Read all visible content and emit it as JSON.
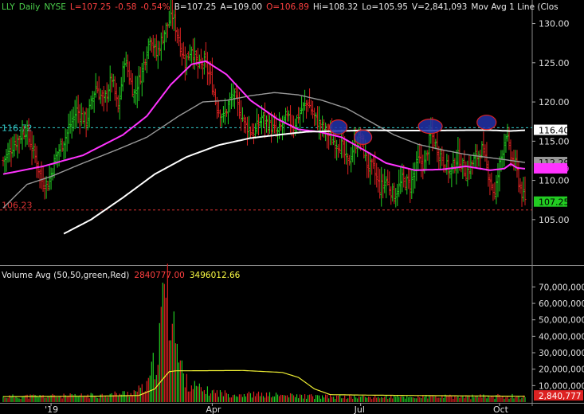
{
  "header": {
    "symbol": "LLY",
    "period": "Daily",
    "exchange": "NYSE",
    "last": "L=107.25",
    "change": "-0.58",
    "change_pct": "-0.54%",
    "bid": "B=107.25",
    "ask": "A=109.00",
    "open": "O=106.89",
    "high": "Hi=108.32",
    "low": "Lo=105.95",
    "volume": "V=2,841,093",
    "indicator": "Mov Avg 1 Line (Clos"
  },
  "volume_header": {
    "title": "Volume Avg (50,50,green,Red)",
    "vol": "2840777.00",
    "avg": "3496012.66"
  },
  "colors": {
    "up": "#22cc22",
    "down": "#dd2222",
    "ma50": "#ff33ff",
    "ma100": "#999999",
    "ma200": "#ffffff",
    "vol_avg": "#eeee33",
    "cyan_line": "#33cccc",
    "red_line": "#dd3333",
    "ellipse_fill": "#2233aa",
    "ellipse_edge": "#dd2222"
  },
  "chart_data": [
    {
      "type": "candlestick",
      "title": "",
      "price_axis_labels": [
        "130.00",
        "125.00",
        "120.00",
        "115.00",
        "110.00",
        "105.00"
      ],
      "ylim": [
        99.2,
        133
      ],
      "x_labels": [
        "'19",
        "Apr",
        "Jul",
        "Oct"
      ],
      "x_label_pos_days": [
        30,
        131,
        224,
        311
      ],
      "days_total": 327,
      "price_tags": [
        {
          "label": "116.40",
          "value": 116.4,
          "color": "#ffffff",
          "text": "#000000"
        },
        {
          "label": "112.29",
          "value": 112.29,
          "color": "#999999",
          "text": "#000000"
        },
        {
          "label": "111.49",
          "value": 111.49,
          "color": "#ff33ff",
          "text": "#ff33ff"
        },
        {
          "label": "107.25",
          "value": 107.25,
          "color": "#22cc22",
          "text": "#000000"
        }
      ],
      "hlines": [
        {
          "label": "116.72",
          "value": 116.72,
          "color": "#33cccc"
        },
        {
          "label": "106.23",
          "value": 106.23,
          "color": "#dd3333"
        }
      ],
      "close_anchors": [
        [
          0,
          112.5
        ],
        [
          8,
          115
        ],
        [
          14,
          116.5
        ],
        [
          20,
          113
        ],
        [
          24,
          110
        ],
        [
          28,
          109.5
        ],
        [
          33,
          113
        ],
        [
          40,
          116
        ],
        [
          46,
          119
        ],
        [
          52,
          117.5
        ],
        [
          58,
          122
        ],
        [
          63,
          120
        ],
        [
          68,
          123
        ],
        [
          72,
          119
        ],
        [
          76,
          125.5
        ],
        [
          82,
          121
        ],
        [
          87,
          124
        ],
        [
          92,
          128.5
        ],
        [
          96,
          126
        ],
        [
          101,
          129
        ],
        [
          106,
          131
        ],
        [
          110,
          128
        ],
        [
          114,
          125
        ],
        [
          118,
          127
        ],
        [
          122,
          124.5
        ],
        [
          126,
          125
        ],
        [
          130,
          123
        ],
        [
          134,
          119.5
        ],
        [
          138,
          118
        ],
        [
          144,
          121
        ],
        [
          148,
          119
        ],
        [
          152,
          117
        ],
        [
          157,
          116
        ],
        [
          162,
          118
        ],
        [
          167,
          117
        ],
        [
          172,
          116
        ],
        [
          177,
          118
        ],
        [
          182,
          117
        ],
        [
          187,
          119
        ],
        [
          191,
          120
        ],
        [
          195,
          118
        ],
        [
          199,
          117
        ],
        [
          203,
          116
        ],
        [
          207,
          115
        ],
        [
          212,
          114.5
        ],
        [
          216,
          112
        ],
        [
          220,
          114.5
        ],
        [
          224,
          115.5
        ],
        [
          228,
          112
        ],
        [
          232,
          111.5
        ],
        [
          236,
          109
        ],
        [
          240,
          110
        ],
        [
          245,
          108
        ],
        [
          250,
          110
        ],
        [
          255,
          109.5
        ],
        [
          260,
          112.5
        ],
        [
          264,
          112
        ],
        [
          268,
          116
        ],
        [
          272,
          114
        ],
        [
          276,
          112.5
        ],
        [
          280,
          111
        ],
        [
          285,
          113
        ],
        [
          290,
          111
        ],
        [
          295,
          112.5
        ],
        [
          300,
          114
        ],
        [
          304,
          111
        ],
        [
          308,
          108
        ],
        [
          311,
          112
        ],
        [
          315,
          116
        ],
        [
          318,
          113
        ],
        [
          321,
          112
        ],
        [
          324,
          109
        ],
        [
          327,
          107.25
        ]
      ],
      "ma50": [
        [
          0,
          110.8
        ],
        [
          25,
          111.8
        ],
        [
          50,
          113.2
        ],
        [
          75,
          115.8
        ],
        [
          90,
          118.2
        ],
        [
          105,
          122.2
        ],
        [
          118,
          124.8
        ],
        [
          127,
          125.2
        ],
        [
          140,
          123.5
        ],
        [
          155,
          120.2
        ],
        [
          172,
          117.8
        ],
        [
          185,
          116.5
        ],
        [
          198,
          116.2
        ],
        [
          212,
          115.5
        ],
        [
          225,
          114.0
        ],
        [
          240,
          112.2
        ],
        [
          258,
          111.3
        ],
        [
          275,
          111.4
        ],
        [
          290,
          111.8
        ],
        [
          305,
          111.3
        ],
        [
          314,
          111.5
        ],
        [
          318,
          112.1
        ],
        [
          322,
          111.6
        ],
        [
          327,
          111.49
        ]
      ],
      "ma100": [
        [
          0,
          106.5
        ],
        [
          15,
          109.5
        ],
        [
          30,
          110.5
        ],
        [
          50,
          112.2
        ],
        [
          70,
          113.8
        ],
        [
          90,
          115.5
        ],
        [
          110,
          118.2
        ],
        [
          125,
          120.0
        ],
        [
          140,
          120.2
        ],
        [
          155,
          120.8
        ],
        [
          170,
          121.2
        ],
        [
          185,
          120.9
        ],
        [
          200,
          120.2
        ],
        [
          215,
          119.2
        ],
        [
          230,
          117.5
        ],
        [
          245,
          115.8
        ],
        [
          260,
          114.6
        ],
        [
          275,
          113.9
        ],
        [
          290,
          113.3
        ],
        [
          305,
          112.9
        ],
        [
          316,
          112.6
        ],
        [
          327,
          112.29
        ]
      ],
      "ma200": [
        [
          38,
          103.2
        ],
        [
          55,
          105.0
        ],
        [
          75,
          107.8
        ],
        [
          95,
          110.8
        ],
        [
          115,
          113.0
        ],
        [
          135,
          114.5
        ],
        [
          155,
          115.4
        ],
        [
          172,
          115.8
        ],
        [
          190,
          116.2
        ],
        [
          210,
          116.3
        ],
        [
          230,
          116.4
        ],
        [
          250,
          116.35
        ],
        [
          270,
          116.35
        ],
        [
          290,
          116.4
        ],
        [
          305,
          116.4
        ],
        [
          318,
          116.3
        ],
        [
          327,
          116.4
        ]
      ],
      "ellipses": [
        {
          "day": 244,
          "price": 116.8
        },
        {
          "day": 262,
          "price": 115.5
        },
        {
          "day": 311,
          "price": 116.9
        },
        {
          "day": 352,
          "price": 117.4
        }
      ]
    },
    {
      "type": "bar",
      "title": "Volume",
      "axis_labels": [
        "70,000,000",
        "60,000,000",
        "50,000,000",
        "40,000,000",
        "30,000,000",
        "20,000,000",
        "10,000,000"
      ],
      "ylim": [
        0,
        76000000
      ],
      "last_tag": "2,840,777",
      "vol_anchors": [
        [
          0,
          3200000.0
        ],
        [
          20,
          3500000.0
        ],
        [
          40,
          3600000.0
        ],
        [
          60,
          4000000.0
        ],
        [
          80,
          5500000.0
        ],
        [
          90,
          9000000.0
        ],
        [
          95,
          24000000.0
        ],
        [
          98,
          35000000.0
        ],
        [
          100,
          60000000.0
        ],
        [
          102,
          76000000.0
        ],
        [
          104,
          45000000.0
        ],
        [
          106,
          72000000.0
        ],
        [
          108,
          38000000.0
        ],
        [
          110,
          25000000.0
        ],
        [
          115,
          12000000.0
        ],
        [
          125,
          7000000.0
        ],
        [
          140,
          5000000.0
        ],
        [
          160,
          4500000.0
        ],
        [
          180,
          3800000.0
        ],
        [
          200,
          3200000.0
        ],
        [
          230,
          3000000.0
        ],
        [
          260,
          3100000.0
        ],
        [
          290,
          3200000.0
        ],
        [
          320,
          3500000.0
        ],
        [
          327,
          2840000.0
        ]
      ],
      "avg_anchors": [
        [
          0,
          3300000.0
        ],
        [
          60,
          3600000.0
        ],
        [
          85,
          4000000.0
        ],
        [
          95,
          8000000.0
        ],
        [
          100,
          14000000.0
        ],
        [
          104,
          18500000.0
        ],
        [
          108,
          19000000.0
        ],
        [
          150,
          19200000.0
        ],
        [
          175,
          18000000.0
        ],
        [
          185,
          15000000.0
        ],
        [
          195,
          8000000.0
        ],
        [
          205,
          4500000.0
        ],
        [
          230,
          4200000.0
        ],
        [
          270,
          3900000.0
        ],
        [
          327,
          3500000.0
        ]
      ]
    }
  ]
}
